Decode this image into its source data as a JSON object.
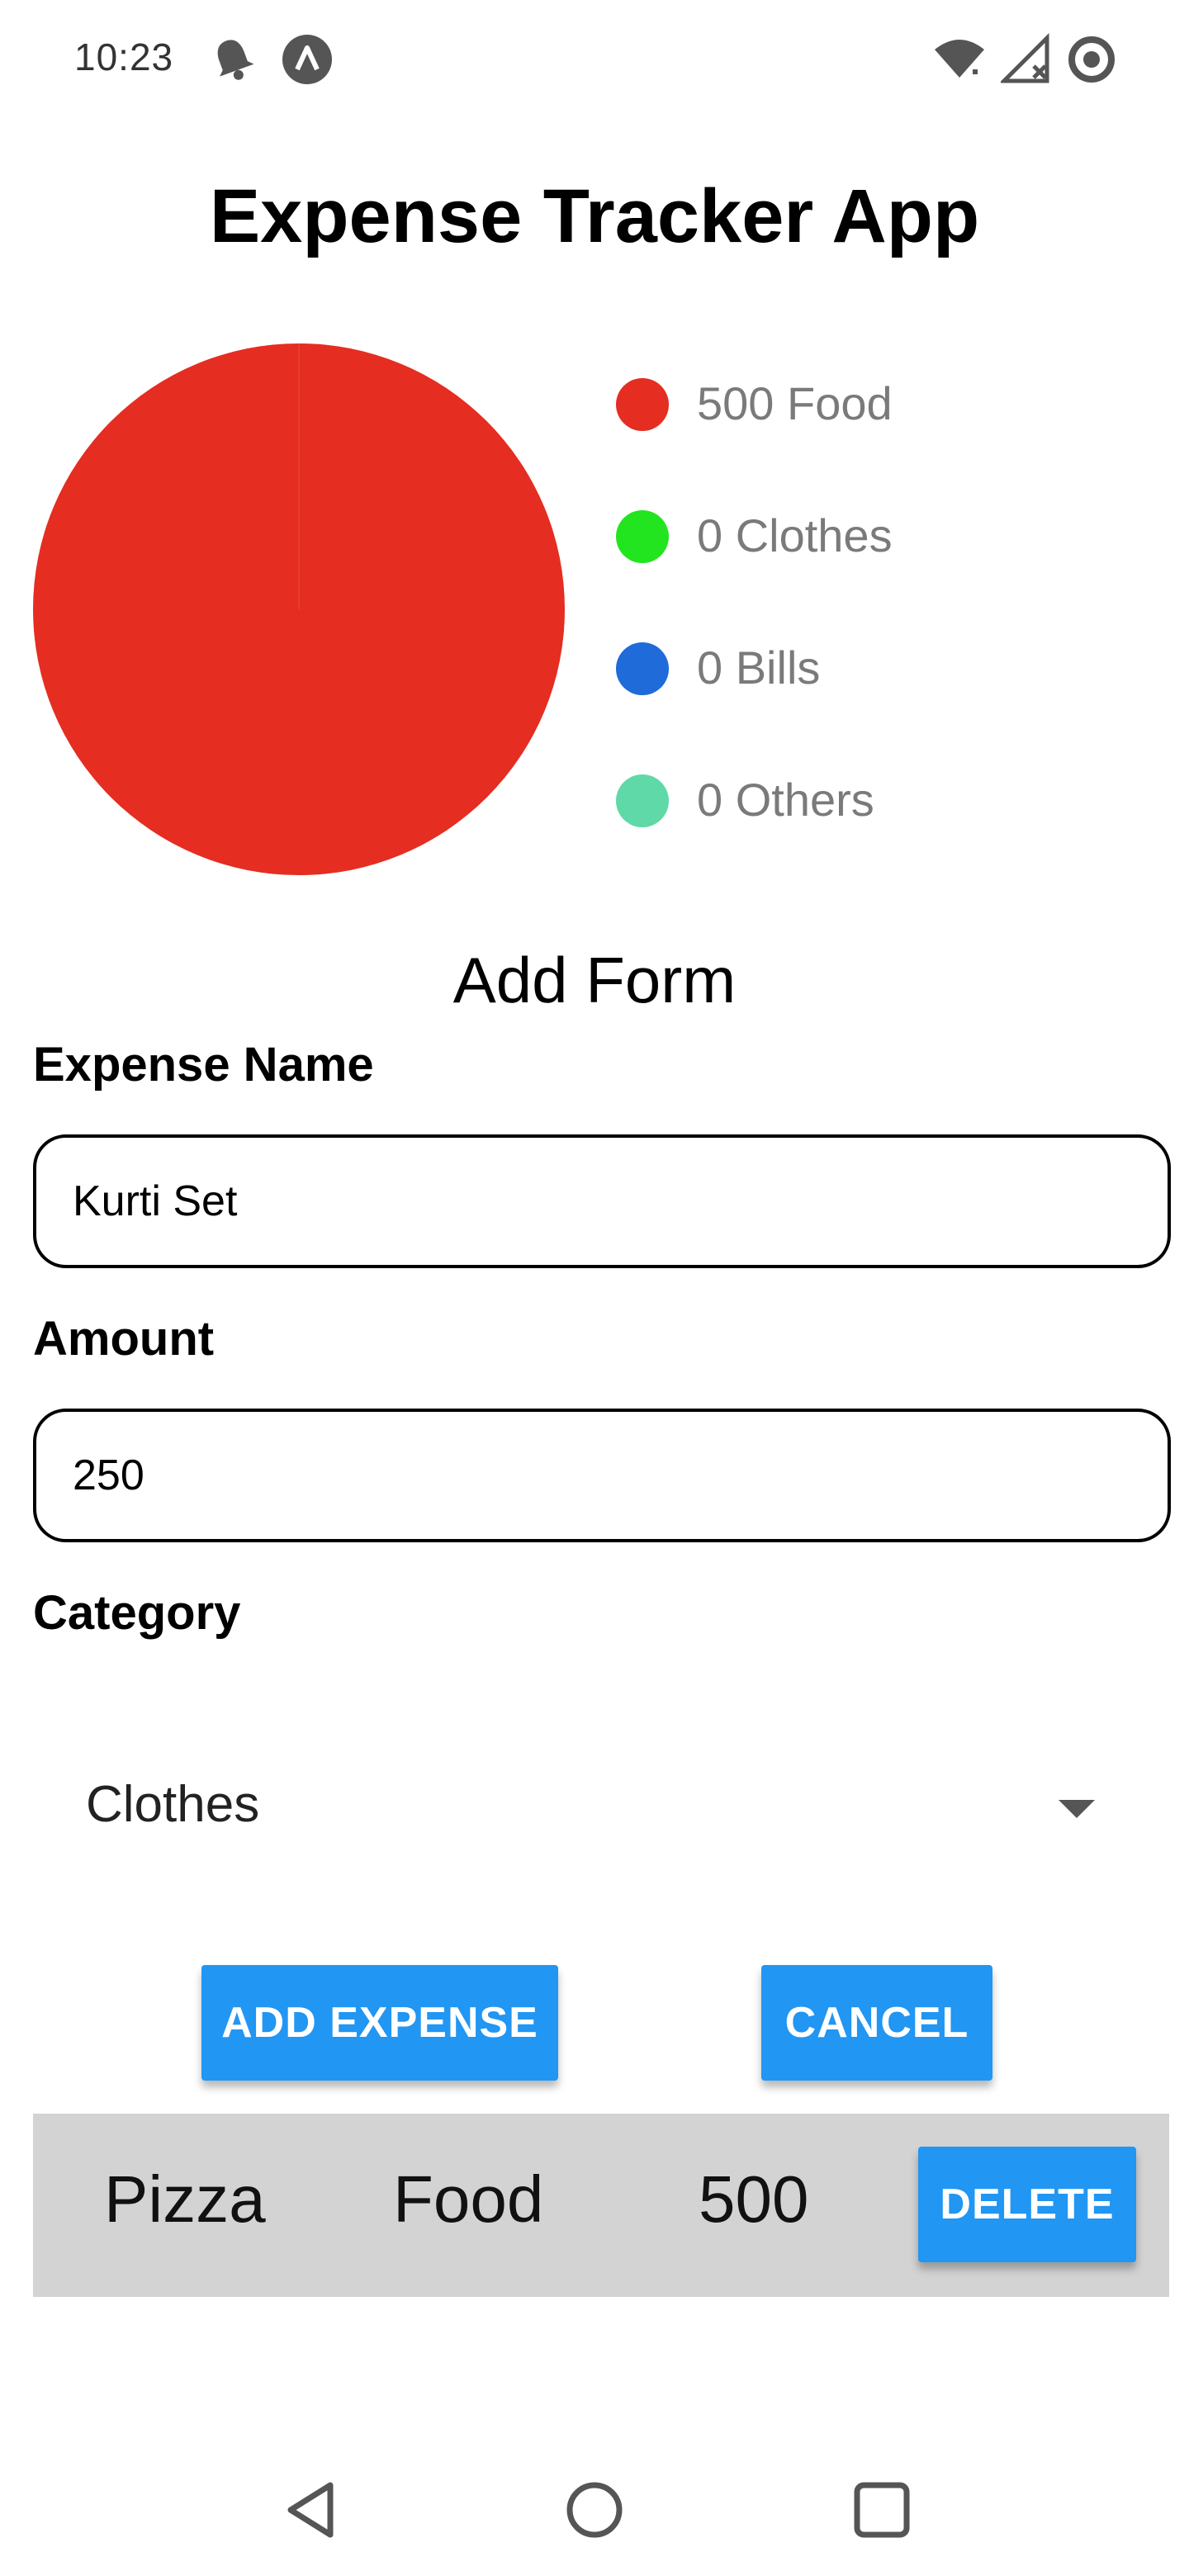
{
  "status_bar": {
    "time": "10:23",
    "left_icons": [
      "notification-bell-icon",
      "expo-app-icon"
    ],
    "right_icons": [
      "wifi-icon",
      "cell-signal-no-service-icon",
      "battery-ring-icon"
    ]
  },
  "app": {
    "title": "Expense Tracker App"
  },
  "chart_data": {
    "type": "pie",
    "slices": [
      {
        "label": "Food",
        "value": 500,
        "color": "#e52d21"
      },
      {
        "label": "Clothes",
        "value": 0,
        "color": "#22e51f"
      },
      {
        "label": "Bills",
        "value": 0,
        "color": "#1e6bd9"
      },
      {
        "label": "Others",
        "value": 0,
        "color": "#5fd9a7"
      }
    ],
    "legend_placement": "right"
  },
  "legend": {
    "items": [
      {
        "text": "500 Food"
      },
      {
        "text": "0 Clothes"
      },
      {
        "text": "0 Bills"
      },
      {
        "text": "0 Others"
      }
    ]
  },
  "form": {
    "title": "Add Form",
    "name_label": "Expense Name",
    "name_value": "Kurti Set",
    "amount_label": "Amount",
    "amount_value": "250",
    "category_label": "Category",
    "category_value": "Clothes",
    "add_button": "ADD EXPENSE",
    "cancel_button": "CANCEL"
  },
  "expenses": [
    {
      "name": "Pizza",
      "category": "Food",
      "amount": "500",
      "delete_label": "DELETE"
    }
  ],
  "nav_bar": {
    "icons": [
      "back-icon",
      "home-icon",
      "recents-icon"
    ]
  }
}
